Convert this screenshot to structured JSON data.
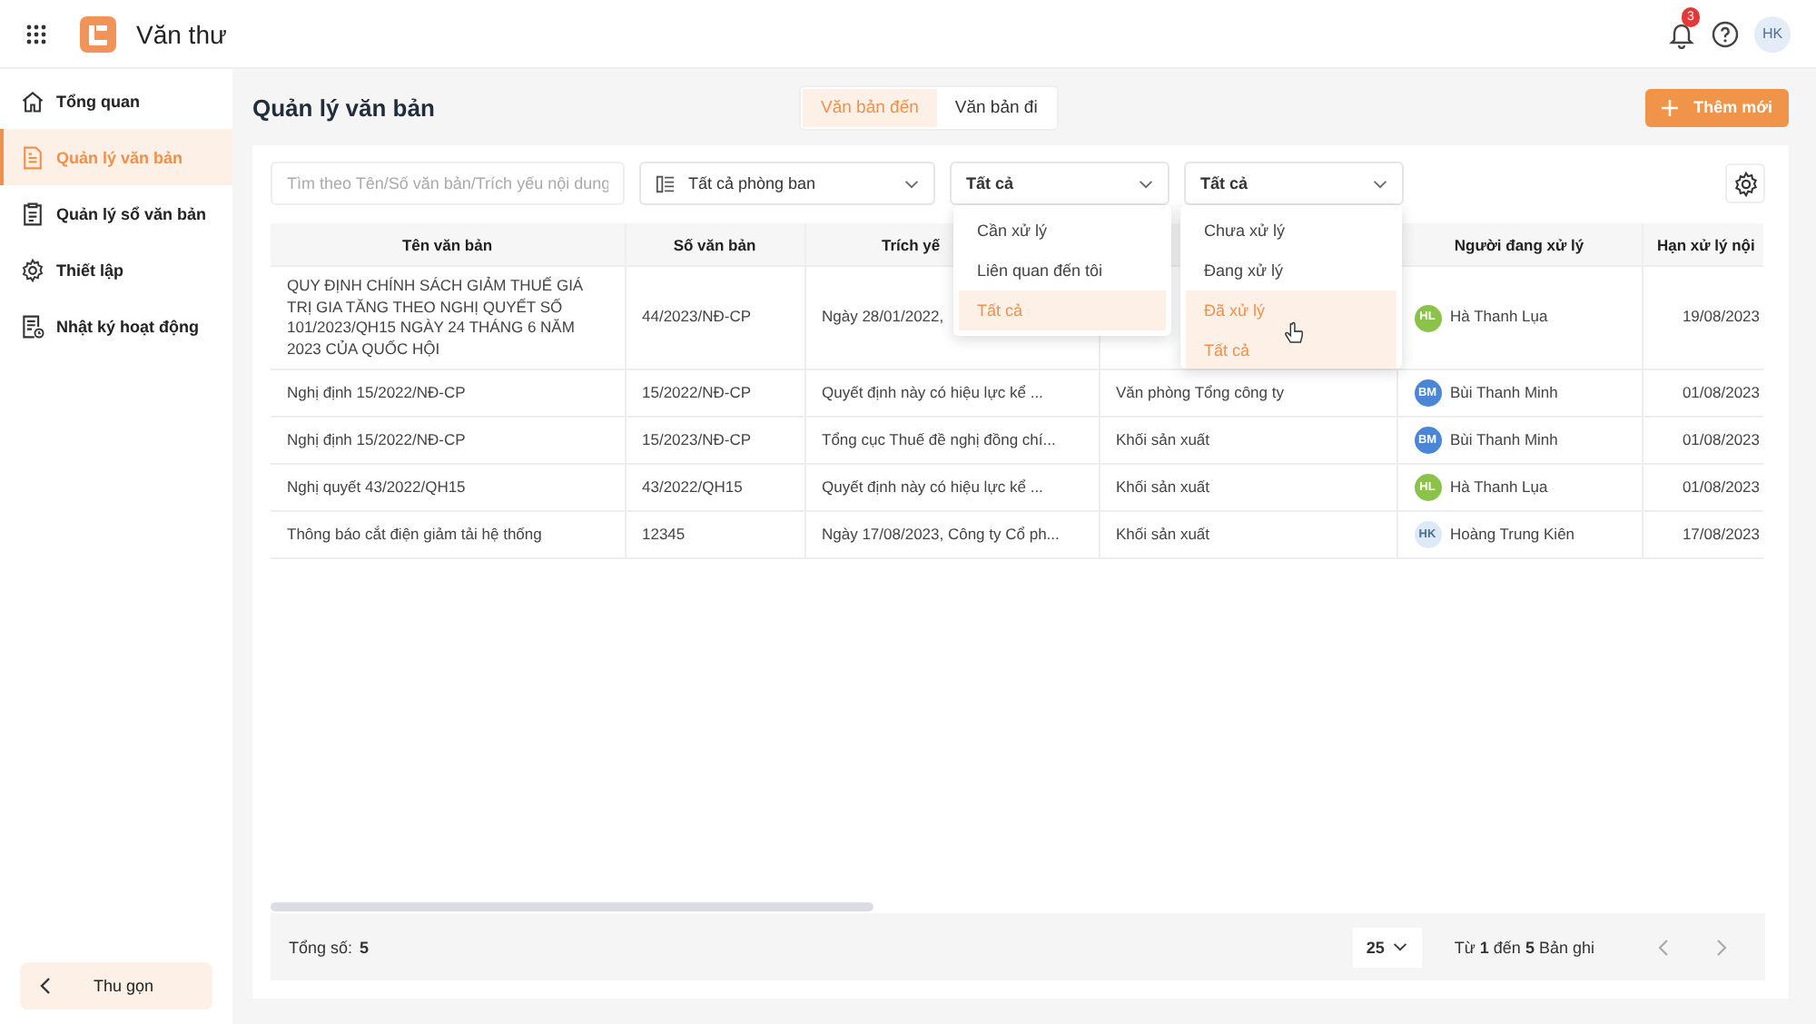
{
  "app": {
    "title": "Văn thư",
    "notifications": "3",
    "user_initials": "HK"
  },
  "sidebar": {
    "items": [
      {
        "label": "Tổng quan",
        "selected": false
      },
      {
        "label": "Quản lý văn bản",
        "selected": true
      },
      {
        "label": "Quản lý sổ văn bản",
        "selected": false
      },
      {
        "label": "Thiết lập",
        "selected": false
      },
      {
        "label": "Nhật ký hoạt động",
        "selected": false
      }
    ],
    "collapse": "Thu gọn"
  },
  "page": {
    "title": "Quản lý văn bản",
    "add_button": "Thêm mới"
  },
  "tabs": [
    {
      "label": "Văn bản đến",
      "selected": true
    },
    {
      "label": "Văn bản đi",
      "selected": false
    }
  ],
  "filters": {
    "search": {
      "placeholder": "Tìm theo Tên/Số văn bản/Trích yếu nội dung"
    },
    "department": "Tất cả phòng ban",
    "scope": "Tất cả",
    "status": "Tất cả"
  },
  "dropdowns": [
    {
      "items": [
        {
          "label": "Cần xử lý",
          "selected": false
        },
        {
          "label": "Liên quan đến tôi",
          "selected": false
        },
        {
          "label": "Tất cả",
          "selected": true
        }
      ]
    },
    {
      "items": [
        {
          "label": "Chưa xử lý",
          "selected": false
        },
        {
          "label": "Đang xử lý",
          "selected": false
        },
        {
          "label": "Đã xử lý",
          "selected": true
        },
        {
          "label": "Tất cả",
          "selected": true
        }
      ]
    }
  ],
  "table": {
    "columns": [
      "Tên văn bản",
      "Số văn bản",
      "Trích yế",
      "",
      "Người đang xử lý",
      "Hạn xử lý nội"
    ],
    "rows": [
      {
        "name": "QUY ĐỊNH CHÍNH SÁCH GIẢM THUẾ GIÁ TRỊ GIA TĂNG THEO NGHỊ QUYẾT SỐ 101/2023/QH15 NGÀY 24 THÁNG 6 NĂM 2023 CỦA QUỐC HỘI",
        "number": "44/2023/NĐ-CP",
        "summary": "Ngày 28/01/2022,",
        "handler": {
          "initials": "HL",
          "name": "Hà Thanh Lụa",
          "color": "#8bc34a"
        },
        "deadline": "19/08/2023"
      },
      {
        "name": "Nghị định 15/2022/NĐ-CP",
        "number": "15/2022/NĐ-CP",
        "summary": "Quyết định này có hiệu lực kể ...",
        "department": "Văn phòng Tổng công ty",
        "handler": {
          "initials": "BM",
          "name": "Bùi Thanh Minh",
          "color": "#4a86d6"
        },
        "deadline": "01/08/2023"
      },
      {
        "name": "Nghị định 15/2022/NĐ-CP",
        "number": "15/2023/NĐ-CP",
        "summary": "Tổng cục Thuế đề nghị đồng chí...",
        "department": "Khối sản xuất",
        "handler": {
          "initials": "BM",
          "name": "Bùi Thanh Minh",
          "color": "#4a86d6"
        },
        "deadline": "01/08/2023"
      },
      {
        "name": "Nghị quyết 43/2022/QH15",
        "number": "43/2022/QH15",
        "summary": "Quyết định này có hiệu lực kể ...",
        "department": "Khối sản xuất",
        "handler": {
          "initials": "HL",
          "name": "Hà Thanh Lụa",
          "color": "#8bc34a"
        },
        "deadline": "01/08/2023"
      },
      {
        "name": "Thông báo cắt điện giảm tải hệ thống",
        "number": "12345",
        "summary": "Ngày 17/08/2023, Công ty Cổ ph...",
        "department": "Khối sản xuất",
        "handler": {
          "initials": "HK",
          "name": "Hoàng Trung Kiên",
          "color": "#dde9f6"
        },
        "deadline": "17/08/2023"
      }
    ]
  },
  "footer": {
    "total_label": "Tổng số:",
    "total": "5",
    "page_size": "25",
    "range": "Từ **1** đến **5** Bản ghi"
  }
}
